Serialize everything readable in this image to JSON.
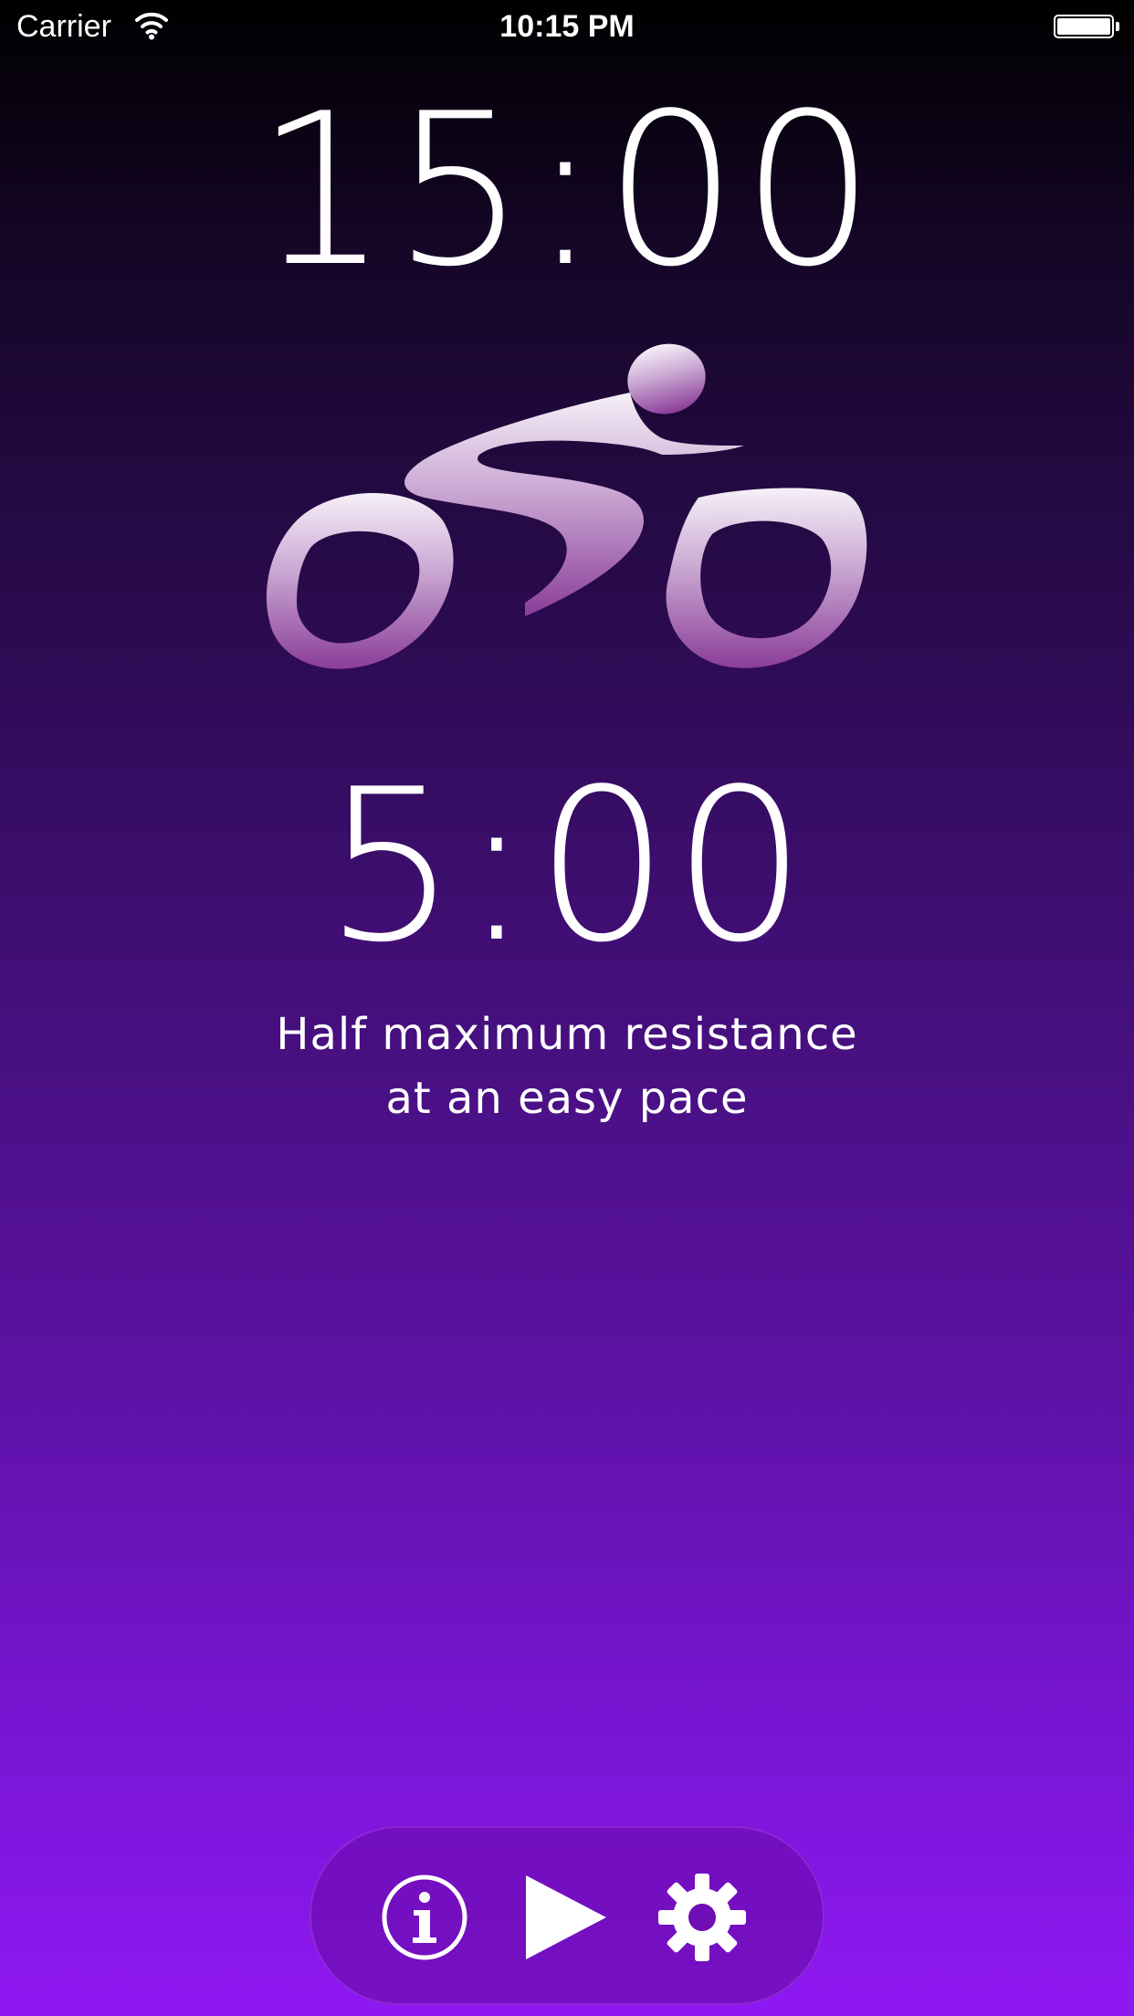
{
  "status_bar": {
    "carrier": "Carrier",
    "time": "10:15 PM"
  },
  "workout": {
    "total_time": "15:00",
    "interval_time": "5:00",
    "instruction_line1": "Half maximum resistance",
    "instruction_line2": "at an easy pace"
  },
  "controls": {
    "info_icon": "info-icon",
    "play_icon": "play-icon",
    "settings_icon": "gear-icon"
  },
  "colors": {
    "background_top": "#000000",
    "background_bottom": "#8f18f2",
    "control_bar": "#6e0eb4",
    "cyclist_light": "#f2eaf6",
    "cyclist_dark": "#8a3d98"
  }
}
